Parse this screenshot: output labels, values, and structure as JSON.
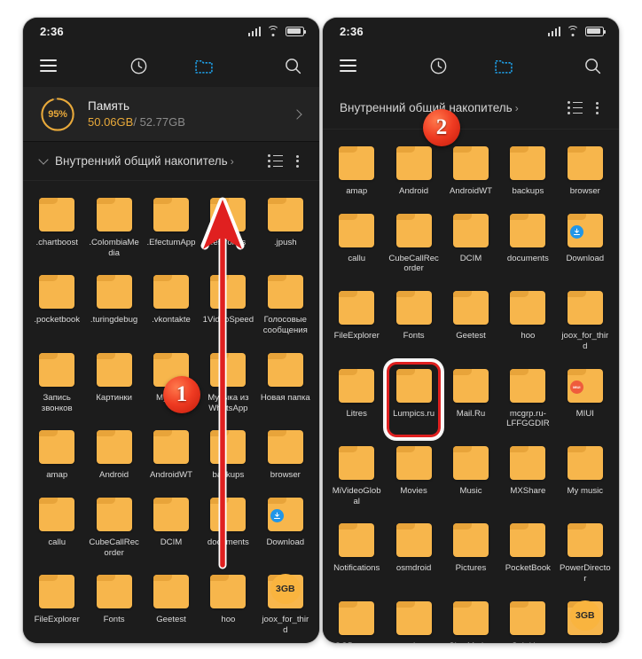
{
  "statusbar": {
    "time": "2:36",
    "signal_icon": "signal-bars-icon",
    "wifi_icon": "wifi-icon",
    "battery_icon": "battery-icon"
  },
  "toolbar": {
    "menu_icon": "hamburger-menu-icon",
    "recent_icon": "clock-recent-icon",
    "folders_icon": "folder-tab-icon",
    "search_icon": "search-icon"
  },
  "storage": {
    "percent": "95%",
    "percent_value": 95,
    "title": "Память",
    "used": "50.06GB",
    "separator": "/",
    "total": " 52.77GB",
    "chevron_icon": "chevron-right-icon",
    "ring_color": "#e8a93a"
  },
  "breadcrumb": {
    "collapse_icon": "chevron-down-icon",
    "label": "Внутренний общий накопитель",
    "arrow": "›",
    "list_icon": "list-view-icon",
    "more_icon": "kebab-more-icon"
  },
  "left_phone": {
    "folders": [
      {
        "name": ".chartboost"
      },
      {
        "name": ".ColombiaMedia"
      },
      {
        "name": ".EfectumApp"
      },
      {
        "name": ".estrongs"
      },
      {
        "name": ".jpush"
      },
      {
        "name": ".pocketbook"
      },
      {
        "name": ".turingdebug"
      },
      {
        "name": ".vkontakte"
      },
      {
        "name": "1VideoSpeed"
      },
      {
        "name": "Голосовые сообщения"
      },
      {
        "name": "Запись звонков"
      },
      {
        "name": "Картинки"
      },
      {
        "name": "Музыка"
      },
      {
        "name": "Музыка из WhatsApp"
      },
      {
        "name": "Новая папка"
      },
      {
        "name": "amap"
      },
      {
        "name": "Android"
      },
      {
        "name": "AndroidWT"
      },
      {
        "name": "backups"
      },
      {
        "name": "browser"
      },
      {
        "name": "callu"
      },
      {
        "name": "CubeCallRecorder"
      },
      {
        "name": "DCIM"
      },
      {
        "name": "documents"
      },
      {
        "name": "Download",
        "badge": "download"
      },
      {
        "name": "FileExplorer"
      },
      {
        "name": "Fonts"
      },
      {
        "name": "Geetest"
      },
      {
        "name": "hoo"
      },
      {
        "name": "joox_for_third",
        "size": "3GB"
      }
    ]
  },
  "right_phone": {
    "folders": [
      {
        "name": "amap"
      },
      {
        "name": "Android"
      },
      {
        "name": "AndroidWT"
      },
      {
        "name": "backups"
      },
      {
        "name": "browser"
      },
      {
        "name": "callu"
      },
      {
        "name": "CubeCallRecorder"
      },
      {
        "name": "DCIM"
      },
      {
        "name": "documents"
      },
      {
        "name": "Download",
        "badge": "download"
      },
      {
        "name": "FileExplorer"
      },
      {
        "name": "Fonts"
      },
      {
        "name": "Geetest"
      },
      {
        "name": "hoo"
      },
      {
        "name": "joox_for_third"
      },
      {
        "name": "Litres"
      },
      {
        "name": "Lumpics.ru",
        "highlighted": true
      },
      {
        "name": "Mail.Ru"
      },
      {
        "name": "mcgrp.ru-LFFGGDIR"
      },
      {
        "name": "MIUI",
        "badge": "miui"
      },
      {
        "name": "MiVideoGlobal"
      },
      {
        "name": "Movies"
      },
      {
        "name": "Music"
      },
      {
        "name": "MXShare"
      },
      {
        "name": "My music"
      },
      {
        "name": "Notifications"
      },
      {
        "name": "osmdroid"
      },
      {
        "name": "Pictures"
      },
      {
        "name": "PocketBook"
      },
      {
        "name": "PowerDirector"
      },
      {
        "name": "QQBrowser"
      },
      {
        "name": "ramdump"
      },
      {
        "name": "SlowMotion"
      },
      {
        "name": "Subtitles"
      },
      {
        "name": "systemui",
        "size": "3GB"
      }
    ]
  },
  "annotations": {
    "step_one": "1",
    "step_two": "2",
    "scroll_arrow_icon": "scroll-up-arrow-annotation",
    "highlight_icon": "highlight-box-annotation",
    "accent_color": "#e02020"
  }
}
